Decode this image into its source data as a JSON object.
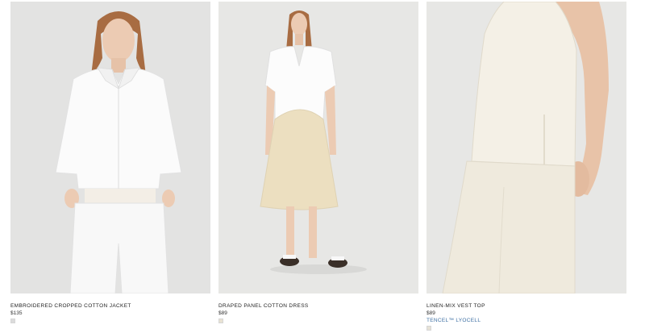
{
  "products": [
    {
      "name": "EMBROIDERED CROPPED COTTON JACKET",
      "price": "$135",
      "swatch_color": "#dcdcdc"
    },
    {
      "name": "DRAPED PANEL COTTON DRESS",
      "price": "$89",
      "swatch_color": "#e8e2d2"
    },
    {
      "name": "LINEN-MIX VEST TOP",
      "price": "$89",
      "tag": "TENCEL™ LYOCELL",
      "swatch_color": "#e6e2d6"
    }
  ],
  "colors": {
    "tag_blue": "#3d6fa3",
    "photo_background": "#e6e6e4"
  }
}
